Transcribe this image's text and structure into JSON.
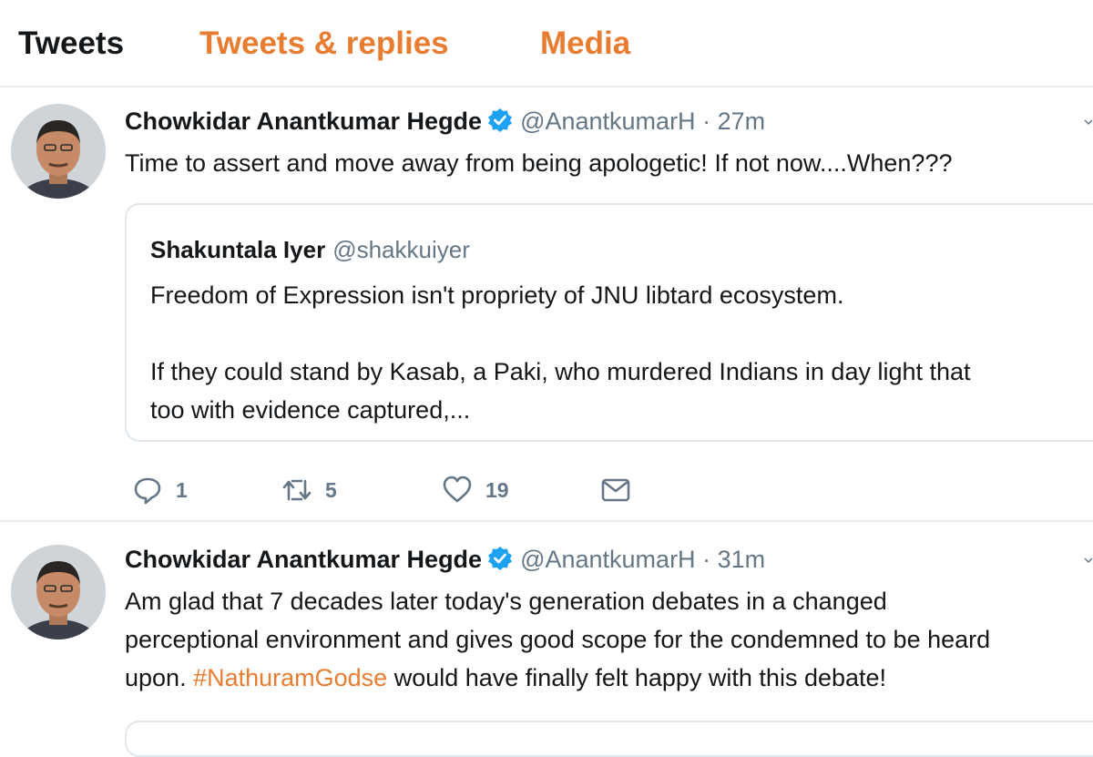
{
  "tabs": [
    {
      "label": "Tweets",
      "active": true
    },
    {
      "label": "Tweets & replies",
      "active": false
    },
    {
      "label": "Media",
      "active": false
    }
  ],
  "colors": {
    "accent": "#e87c30",
    "verified": "#1da1f2",
    "muted": "#657786",
    "text": "#14171a"
  },
  "tweets": [
    {
      "name": "Chowkidar Anantkumar Hegde",
      "handle": "@AnantkumarH",
      "separator": "·",
      "time": "27m",
      "text": "Time to assert and move away from being apologetic!  If not now....When???",
      "quote": {
        "name": "Shakuntala Iyer",
        "handle": "@shakkuiyer",
        "line1": "Freedom of Expression isn't propriety of JNU libtard ecosystem.",
        "line2": "If they could stand by Kasab, a Paki, who murdered Indians in day light that",
        "line3": "too with evidence captured,..."
      },
      "actions": {
        "replies": "1",
        "retweets": "5",
        "likes": "19"
      }
    },
    {
      "name": "Chowkidar Anantkumar Hegde",
      "handle": "@AnantkumarH",
      "separator": "·",
      "time": "31m",
      "line1": "Am glad that 7 decades later today's generation debates in a changed",
      "line2": "perceptional environment and gives good scope for the  condemned to be heard",
      "line3_pre": "upon.  ",
      "hashtag": "#NathuramGodse",
      "line3_post": " would have finally felt happy with this debate!"
    }
  ],
  "icons": {
    "verified": "verified-badge-icon",
    "reply": "reply-icon",
    "retweet": "retweet-icon",
    "like": "heart-icon",
    "message": "direct-message-icon",
    "more": "chevron-down-icon"
  }
}
